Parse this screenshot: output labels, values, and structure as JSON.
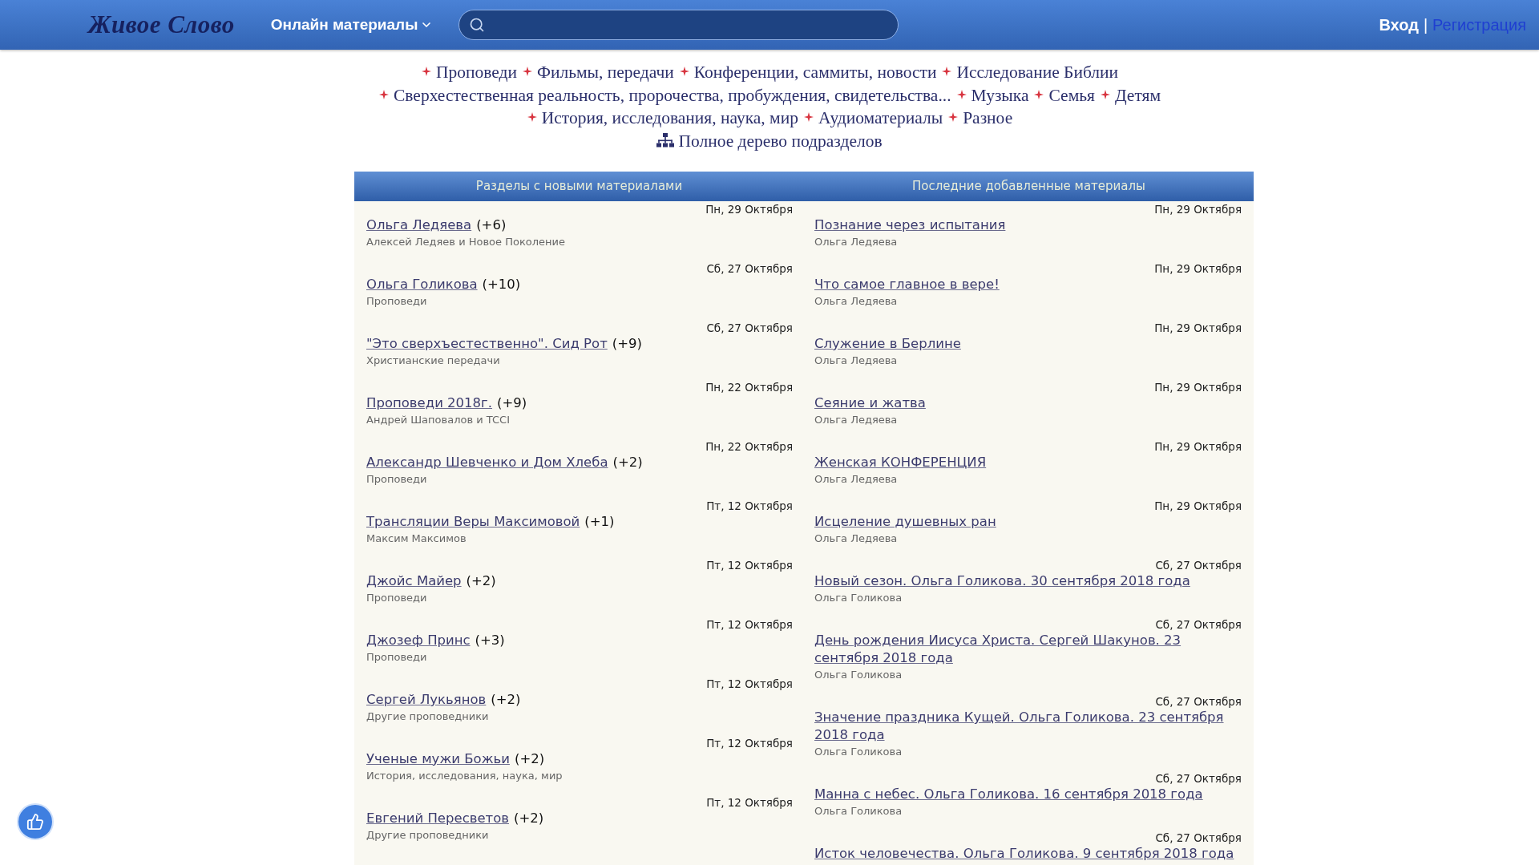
{
  "header": {
    "logo": "Живое Слово",
    "menu": {
      "label": "Онлайн материалы"
    },
    "login": "Вход",
    "separator": "|",
    "register": "Регистрация"
  },
  "categories": [
    [
      "Проповеди",
      "Фильмы, передачи",
      "Конференции, саммиты, новости",
      "Исследование Библии"
    ],
    [
      "Сверхестественная реальность, пророчества, пробуждения, свидетельства...",
      "Музыка",
      "Семья",
      "Детям"
    ],
    [
      "История, исследования, наука, мир",
      "Аудиоматериалы",
      "Разное"
    ]
  ],
  "tree_link": "Полное дерево подразделов",
  "columns": [
    {
      "heading": "Разделы с новыми материалами",
      "items": [
        {
          "date": "Пн, 29 Октября",
          "title": "Ольга Ледяева",
          "count": "(+6)",
          "subtitle": "Алексей Ледяев и Новое Поколение"
        },
        {
          "date": "Сб, 27 Октября",
          "title": "Ольга Голикова",
          "count": "(+10)",
          "subtitle": "Проповеди"
        },
        {
          "date": "Сб, 27 Октября",
          "title": "\"Это сверхъестественно\". Сид Рот",
          "count": "(+9)",
          "subtitle": "Христианские передачи"
        },
        {
          "date": "Пн, 22 Октября",
          "title": "Проповеди 2018г.",
          "count": "(+9)",
          "subtitle": "Андрей Шаповалов и TCCI"
        },
        {
          "date": "Пн, 22 Октября",
          "title": "Александр Шевченко и Дом Хлеба",
          "count": "(+2)",
          "subtitle": "Проповеди"
        },
        {
          "date": "Пт, 12 Октября",
          "title": "Трансляции Веры Максимовой",
          "count": "(+1)",
          "subtitle": "Максим Максимов"
        },
        {
          "date": "Пт, 12 Октября",
          "title": "Джойс Майер",
          "count": "(+2)",
          "subtitle": "Проповеди"
        },
        {
          "date": "Пт, 12 Октября",
          "title": "Джозеф Принс",
          "count": "(+3)",
          "subtitle": "Проповеди"
        },
        {
          "date": "Пт, 12 Октября",
          "title": "Сергей Лукьянов",
          "count": "(+2)",
          "subtitle": "Другие проповедники"
        },
        {
          "date": "Пт, 12 Октября",
          "title": "Ученые мужи Божьи",
          "count": "(+2)",
          "subtitle": "История, исследования, наука, мир"
        },
        {
          "date": "Пт, 12 Октября",
          "title": "Евгений Пересветов",
          "count": "(+2)",
          "subtitle": "Другие проповедники"
        }
      ]
    },
    {
      "heading": "Последние добавленные материалы",
      "items": [
        {
          "date": "Пн, 29 Октября",
          "title": "Познание через испытания",
          "subtitle": "Ольга Ледяева"
        },
        {
          "date": "Пн, 29 Октября",
          "title": "Что самое главное в вере!",
          "subtitle": "Ольга Ледяева"
        },
        {
          "date": "Пн, 29 Октября",
          "title": "Служение в Берлине",
          "subtitle": "Ольга Ледяева"
        },
        {
          "date": "Пн, 29 Октября",
          "title": "Сеяние и жатва",
          "subtitle": "Ольга Ледяева"
        },
        {
          "date": "Пн, 29 Октября",
          "title": "Женская КОНФЕРЕНЦИЯ",
          "subtitle": "Ольга Ледяева"
        },
        {
          "date": "Пн, 29 Октября",
          "title": "Исцеление душевных ран",
          "subtitle": "Ольга Ледяева"
        },
        {
          "date": "Сб, 27 Октября",
          "title": "Новый сезон. Ольга Голикова. 30 сентября 2018 года",
          "subtitle": "Ольга Голикова"
        },
        {
          "date": "Сб, 27 Октября",
          "title": "День рождения Иисуса Христа. Сергей Шакунов. 23 сентября 2018 года",
          "subtitle": "Ольга Голикова"
        },
        {
          "date": "Сб, 27 Октября",
          "title": "Значение праздника Кущей. Ольга Голикова. 23 сентября 2018 года",
          "subtitle": "Ольга Голикова"
        },
        {
          "date": "Сб, 27 Октября",
          "title": "Манна с небес. Ольга Голикова. 16 сентября 2018 года",
          "subtitle": "Ольга Голикова"
        },
        {
          "date": "Сб, 27 Октября",
          "title": "Исток человечества. Ольга Голикова. 9 сентября 2018 года"
        }
      ]
    }
  ]
}
